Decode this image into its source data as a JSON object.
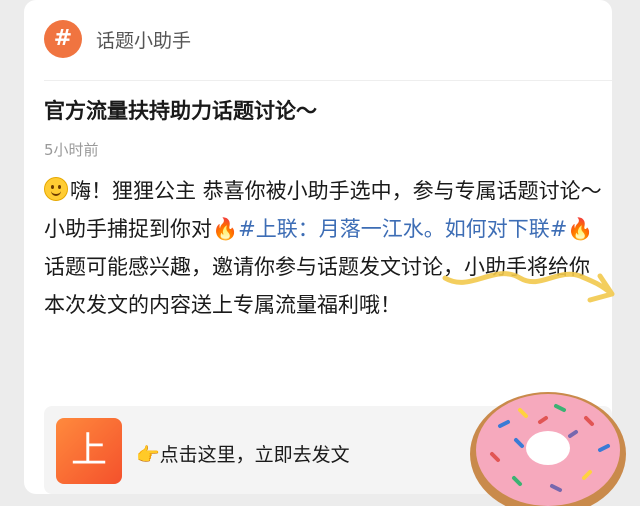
{
  "header": {
    "badge": "#",
    "title": "话题小助手"
  },
  "post": {
    "title": "官方流量扶持助力话题讨论～",
    "time": "5小时前",
    "greeting": "嗨！狸狸公主 恭喜你被小助手选中，参与专属话题讨论～",
    "line2_prefix": "小助手捕捉到你对",
    "topic": "#上联：月落一江水。如何对下联#",
    "line2_suffix": "话题可能感兴趣，邀请你参与话题发文讨论，小助手将给你本次发文的内容送上专属流量福利哦！"
  },
  "cta": {
    "tile_label": "上",
    "text": "点击这里，立即去发文"
  },
  "icons": [
    "hashtag-icon",
    "smile-emoji-icon",
    "fire-emoji-icon",
    "pointing-hand-icon",
    "donut-sticker-icon"
  ],
  "colors": {
    "accent": "#f07440",
    "link": "#3d6db5",
    "scribble": "#f2c94c"
  }
}
